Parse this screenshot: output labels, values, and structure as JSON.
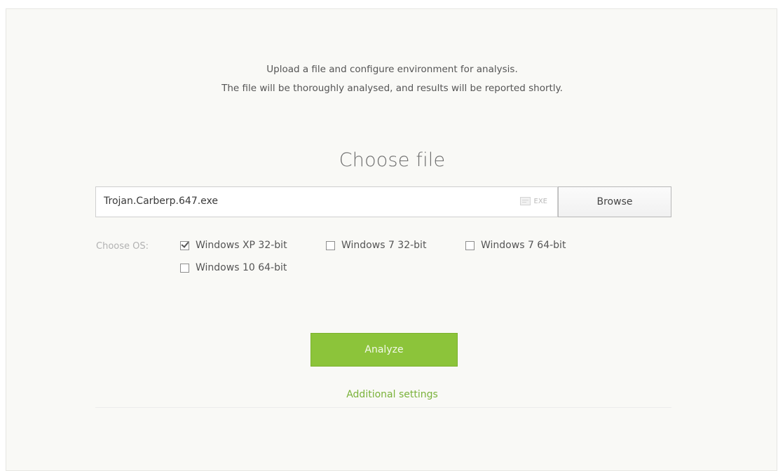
{
  "intro": {
    "line1": "Upload a file and configure environment for analysis.",
    "line2": "The file will be thoroughly analysed, and results will be reported shortly."
  },
  "heading": "Choose file",
  "file": {
    "value": "Trojan.Carberp.647.exe",
    "type_badge": "EXE",
    "browse_label": "Browse"
  },
  "os": {
    "label": "Choose OS:",
    "options": [
      {
        "label": "Windows XP 32-bit",
        "checked": true
      },
      {
        "label": "Windows 7 32-bit",
        "checked": false
      },
      {
        "label": "Windows 7 64-bit",
        "checked": false
      },
      {
        "label": "Windows 10 64-bit",
        "checked": false
      }
    ]
  },
  "analyze_label": "Analyze",
  "additional_settings_label": "Additional settings",
  "colors": {
    "accent": "#8cc43a",
    "link": "#7ab23a"
  }
}
